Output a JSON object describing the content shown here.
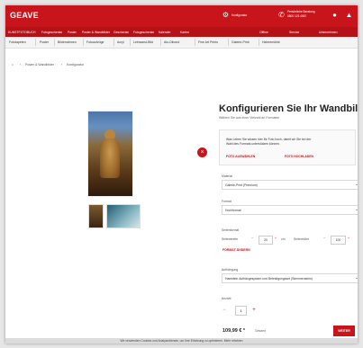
{
  "header": {
    "logo": "GEAVE",
    "konfigurator_label": "Konfigurator",
    "phone_line1": "Persönliche Beratung",
    "phone_line2": "0800 123 4567",
    "user_icon": "user-icon",
    "cart_icon": "cart-icon"
  },
  "categories": [
    "KUNSTFOTOBUCH",
    "Fotogeschenke",
    "Poster",
    "Poster & Wandbilder",
    "Geschenke",
    "Fotogeschenke",
    "Kalender",
    "Karten"
  ],
  "category_right": [
    "Offline",
    "Service",
    "Unternehmen"
  ],
  "nav": [
    "Fototapeten",
    "Poster",
    "Bilderrahmen",
    "Fotoaufzüge",
    "Acryl",
    "Leinwand-Bild",
    "Alu-Dibond",
    "Fine Art Prints",
    "Galerie-Print",
    "Hahnemühle"
  ],
  "breadcrumb": [
    "Poster & Wandbilder",
    "Konfigurator"
  ],
  "product": {
    "title": "Konfigurieren Sie Ihr Wandbild",
    "subtitle": "Wählen Sie aus einer Vielzahl an Formaten",
    "info_line1": "Was Leben Sie wissen hier Ihr Foto hoch, damit wir Sie bei der",
    "info_line2": "Wahl des Formats unterstützen können.",
    "info_link1": "FOTO AUSWÄHLEN",
    "info_link2": "FOTO HOCHLADEN",
    "material_label": "Material",
    "material_value": "Galerie-Print (Premium)",
    "format_label": "Format",
    "format_value": "Hochformat",
    "size_label": "Seitenformat",
    "size_value_label": "Seitenbreite",
    "width_value": "20",
    "height_label": "Seitenhöhe",
    "height_value": "100",
    "unit_cm": "cm",
    "size_link": "FORMAT ÄNDERN",
    "hanging_label": "Aufhängung",
    "hanging_value": "Hamstein Aufhängesystem und Befestigungsset (Stemmenstein)",
    "qty_label": "Anzahl",
    "qty_value": "1",
    "price": "109,99 € *",
    "price_note": "Gesamt",
    "buy_label": "WEITER"
  },
  "cookie_text": "Wir verwenden Cookies und Analysedienste, um Ihre Erfahrung zu optimieren. Mehr erfahren",
  "colors": {
    "brand_red": "#c8141b",
    "accent_blue": "#2a4f9c"
  }
}
